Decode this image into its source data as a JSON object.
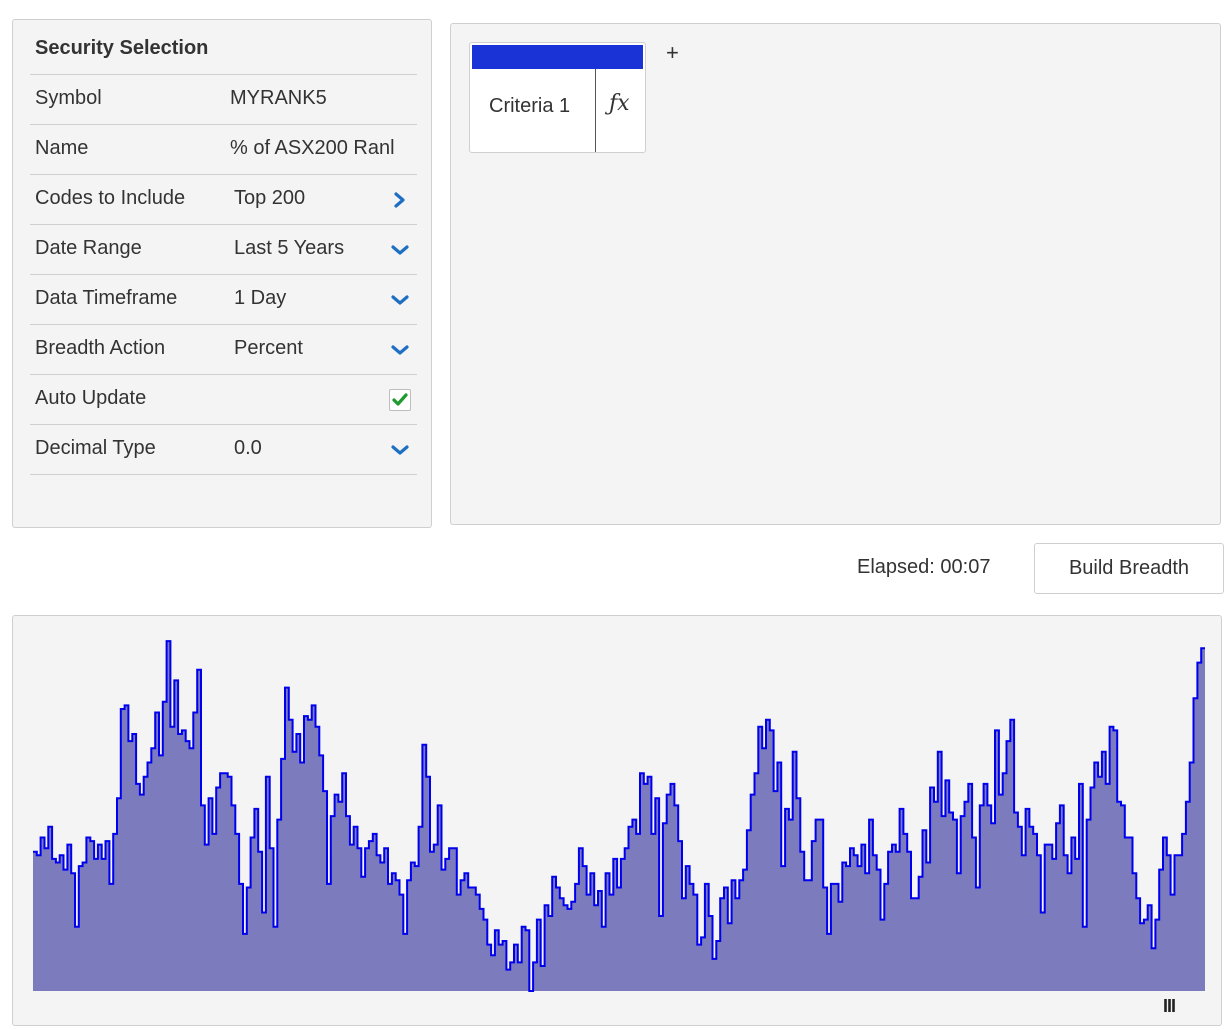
{
  "security_selection": {
    "title": "Security Selection",
    "rows": [
      {
        "label": "Symbol",
        "value": "MYRANK5",
        "control": "none"
      },
      {
        "label": "Name",
        "value": "% of ASX200 Ranl",
        "control": "none"
      },
      {
        "label": "Codes to Include",
        "value": "Top 200",
        "control": "chevron-right-icon"
      },
      {
        "label": "Date Range",
        "value": "Last 5 Years",
        "control": "chevron-down-icon"
      },
      {
        "label": "Data Timeframe",
        "value": "1 Day",
        "control": "chevron-down-icon"
      },
      {
        "label": "Breadth Action",
        "value": "Percent",
        "control": "chevron-down-icon"
      },
      {
        "label": "Auto Update",
        "value": "",
        "control": "checkbox",
        "checked": true
      },
      {
        "label": "Decimal Type",
        "value": "0.0",
        "control": "chevron-down-icon"
      }
    ]
  },
  "criteria": {
    "tabs": [
      {
        "label": "Criteria 1",
        "function_icon": "fx-icon"
      }
    ],
    "add_label": "+"
  },
  "status": {
    "elapsed": "Elapsed: 00:07"
  },
  "actions": {
    "build_label": "Build Breadth"
  },
  "chart_handle_label": "III",
  "colors": {
    "accent_blue": "#1a33d6",
    "chevron_blue": "#1e6fc4",
    "check_green": "#1e9a2e",
    "area_fill": "#7b7bbd",
    "line": "#0000ee",
    "panel_bg": "#f4f4f4"
  },
  "chart_data": {
    "type": "area",
    "title": "",
    "xlabel": "",
    "ylabel": "",
    "ylim": [
      0,
      100
    ],
    "x_count": 260,
    "values": [
      39,
      38,
      43,
      40,
      46,
      37,
      36,
      38,
      34,
      41,
      33,
      18,
      35,
      36,
      43,
      42,
      37,
      41,
      37,
      42,
      30,
      44,
      54,
      79,
      80,
      70,
      72,
      58,
      55,
      60,
      64,
      68,
      78,
      66,
      81,
      98,
      74,
      87,
      72,
      73,
      70,
      68,
      78,
      90,
      52,
      41,
      54,
      44,
      57,
      61,
      61,
      60,
      52,
      44,
      30,
      16,
      29,
      43,
      51,
      39,
      22,
      60,
      40,
      18,
      48,
      65,
      85,
      76,
      67,
      72,
      64,
      77,
      76,
      80,
      74,
      66,
      56,
      30,
      49,
      55,
      53,
      61,
      49,
      41,
      46,
      40,
      32,
      40,
      42,
      44,
      38,
      36,
      40,
      30,
      33,
      31,
      27,
      16,
      31,
      36,
      35,
      46,
      69,
      60,
      39,
      41,
      52,
      34,
      37,
      40,
      40,
      27,
      31,
      33,
      29,
      29,
      27,
      23,
      20,
      13,
      10,
      17,
      13,
      14,
      6,
      8,
      13,
      8,
      18,
      17,
      0,
      8,
      20,
      7,
      24,
      21,
      32,
      29,
      26,
      24,
      23,
      25,
      30,
      40,
      35,
      27,
      33,
      24,
      28,
      18,
      33,
      27,
      37,
      29,
      37,
      40,
      46,
      48,
      44,
      61,
      58,
      60,
      44,
      54,
      21,
      47,
      55,
      58,
      52,
      42,
      26,
      35,
      30,
      27,
      13,
      15,
      30,
      21,
      9,
      14,
      26,
      29,
      19,
      31,
      26,
      31,
      34,
      45,
      55,
      61,
      74,
      68,
      76,
      73,
      56,
      64,
      35,
      51,
      48,
      67,
      54,
      39,
      31,
      31,
      42,
      48,
      48,
      29,
      16,
      30,
      30,
      25,
      36,
      35,
      40,
      38,
      35,
      41,
      33,
      48,
      38,
      34,
      20,
      30,
      39,
      41,
      39,
      51,
      44,
      39,
      26,
      26,
      32,
      45,
      36,
      57,
      53,
      67,
      49,
      59,
      50,
      48,
      33,
      49,
      53,
      58,
      43,
      29,
      52,
      58,
      52,
      47,
      73,
      55,
      61,
      70,
      76,
      50,
      46,
      38,
      51,
      46,
      44,
      38,
      22,
      41,
      41,
      37,
      47,
      52,
      38,
      33,
      43,
      37,
      58,
      18,
      48,
      57,
      64,
      60,
      67,
      58,
      74,
      73,
      53,
      52,
      43,
      43,
      33,
      26,
      19,
      20,
      24,
      12,
      20,
      34,
      43,
      38,
      27,
      38,
      38,
      44,
      53,
      64,
      82,
      92,
      96
    ]
  }
}
